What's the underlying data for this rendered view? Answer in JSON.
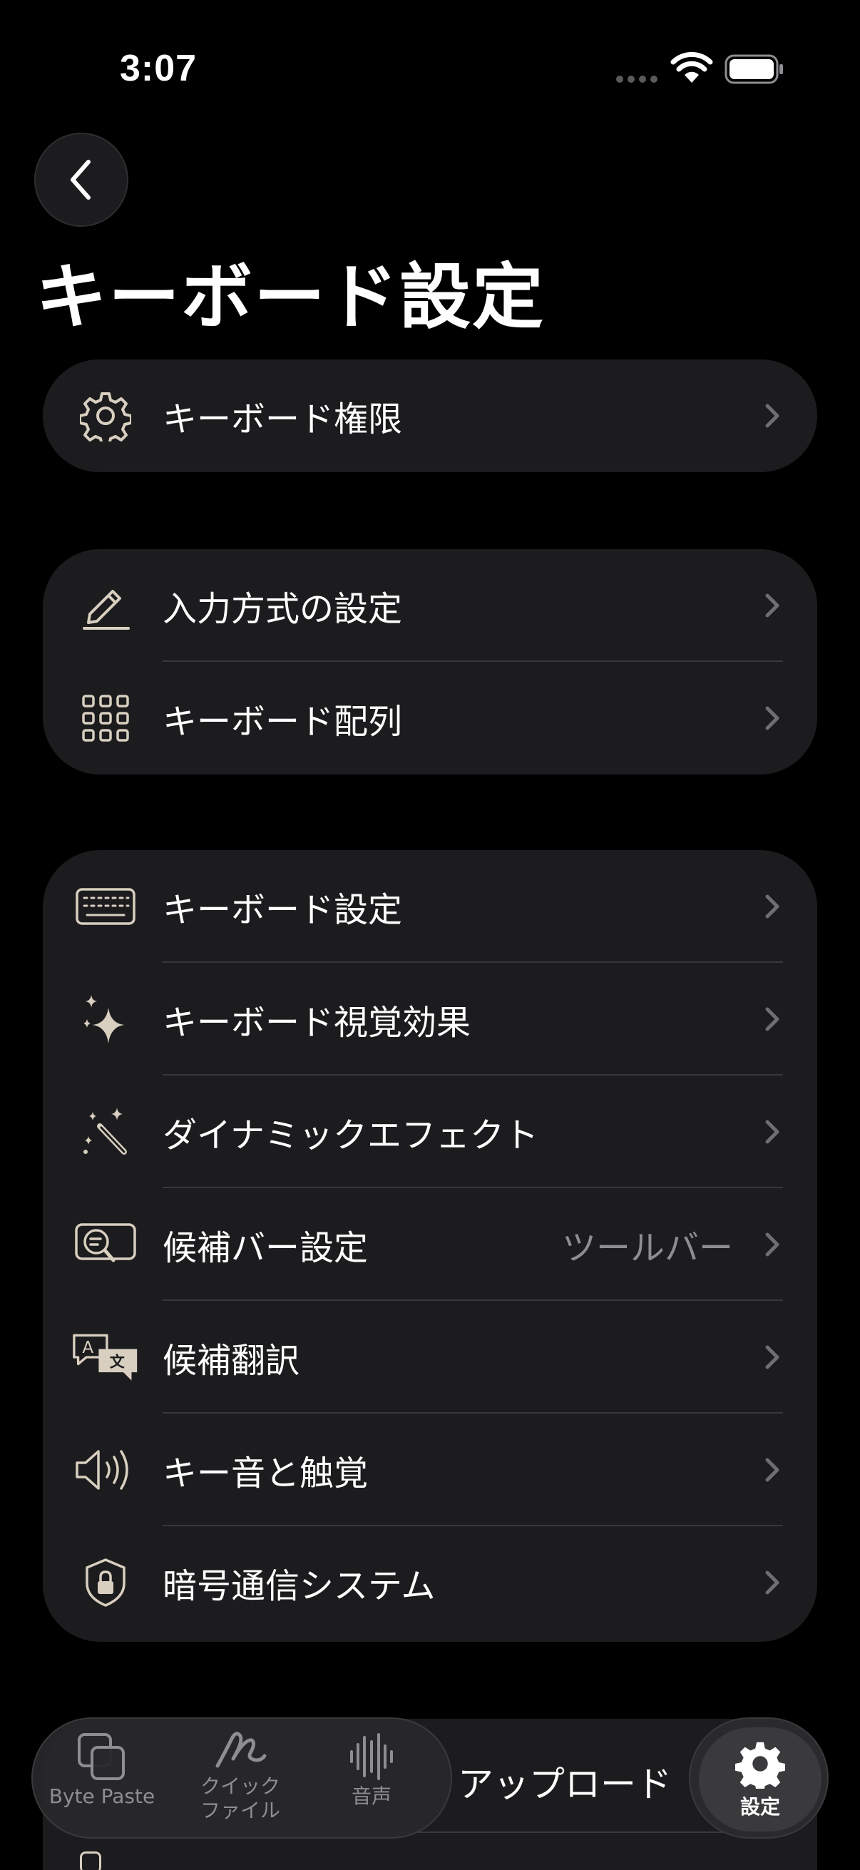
{
  "status": {
    "time": "3:07"
  },
  "header": {
    "title": "キーボード設定"
  },
  "groups": [
    {
      "items": [
        {
          "label": "キーボード権限",
          "icon": "gear-icon"
        }
      ]
    },
    {
      "items": [
        {
          "label": "入力方式の設定",
          "icon": "pencil-icon"
        },
        {
          "label": "キーボード配列",
          "icon": "grid-icon"
        }
      ]
    },
    {
      "items": [
        {
          "label": "キーボード設定",
          "icon": "keyboard-icon"
        },
        {
          "label": "キーボード視覚効果",
          "icon": "sparkles-icon"
        },
        {
          "label": "ダイナミックエフェクト",
          "icon": "magic-wand-icon"
        },
        {
          "label": "候補バー設定",
          "icon": "candidate-search-icon",
          "value": "ツールバー"
        },
        {
          "label": "候補翻訳",
          "icon": "translate-icon"
        },
        {
          "label": "キー音と触覚",
          "icon": "speaker-icon"
        },
        {
          "label": "暗号通信システム",
          "icon": "shield-lock-icon"
        }
      ]
    },
    {
      "items": [
        {
          "label": "アップロード"
        }
      ]
    }
  ],
  "tabbar": {
    "tabs": [
      {
        "label": "Byte Paste",
        "icon": "copy-icon"
      },
      {
        "label_line1": "クイック",
        "label_line2": "ファイル",
        "icon": "scribble-icon"
      },
      {
        "label": "音声",
        "icon": "waveform-icon"
      }
    ],
    "settings": {
      "label": "設定",
      "icon": "gear-icon"
    }
  },
  "colors": {
    "background": "#000000",
    "card": "#1c1c1e",
    "icon_tint": "#d8cfc0",
    "secondary_text": "#8d8d92"
  }
}
